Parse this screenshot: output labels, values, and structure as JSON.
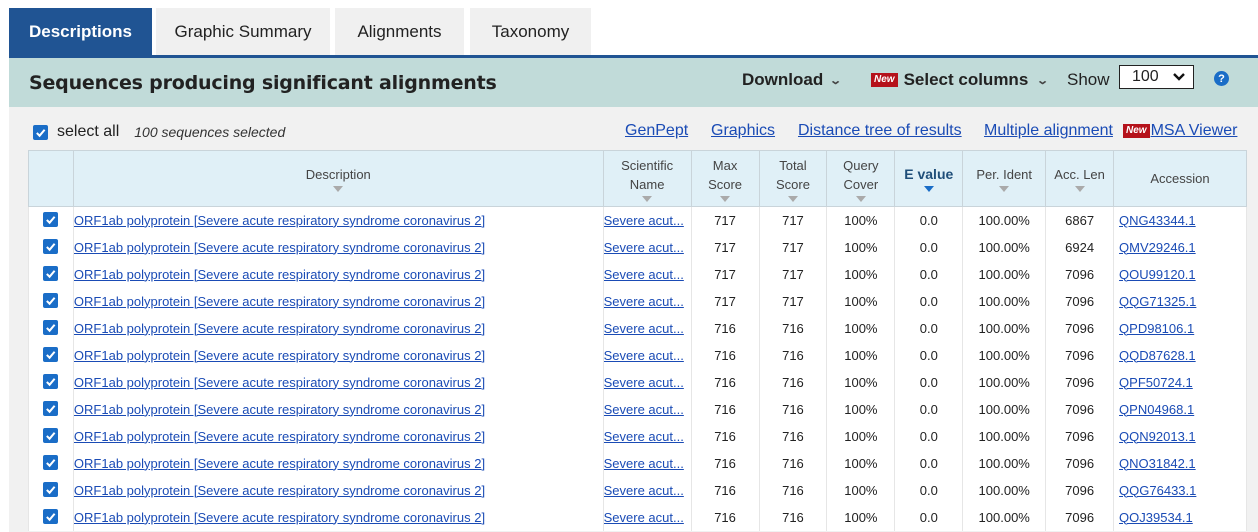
{
  "tabs": [
    "Descriptions",
    "Graphic Summary",
    "Alignments",
    "Taxonomy"
  ],
  "header": {
    "title": "Sequences producing significant alignments",
    "download_label": "Download",
    "new_badge": "New",
    "select_columns_label": "Select columns",
    "show_label": "Show",
    "show_value": "100",
    "help": "?"
  },
  "toolbar": {
    "select_all_label": "select all",
    "selected_count": "100 sequences selected",
    "links": [
      "GenPept",
      "Graphics",
      "Distance tree of results",
      "Multiple alignment"
    ],
    "msa_badge": "New",
    "msa_label": "MSA Viewer"
  },
  "table": {
    "columns": [
      [
        "Description"
      ],
      [
        "Scientific",
        "Name"
      ],
      [
        "Max",
        "Score"
      ],
      [
        "Total",
        "Score"
      ],
      [
        "Query",
        "Cover"
      ],
      [
        "E value"
      ],
      [
        "Per. Ident"
      ],
      [
        "Acc. Len"
      ],
      [
        "Accession"
      ]
    ],
    "rows": [
      {
        "description": "ORF1ab polyprotein [Severe acute respiratory syndrome coronavirus 2]",
        "sci": "Severe acut...",
        "max": "717",
        "total": "717",
        "cover": "100%",
        "evalue": "0.0",
        "ident": "100.00%",
        "len": "6867",
        "acc": "QNG43344.1"
      },
      {
        "description": "ORF1ab polyprotein [Severe acute respiratory syndrome coronavirus 2]",
        "sci": "Severe acut...",
        "max": "717",
        "total": "717",
        "cover": "100%",
        "evalue": "0.0",
        "ident": "100.00%",
        "len": "6924",
        "acc": "QMV29246.1"
      },
      {
        "description": "ORF1ab polyprotein [Severe acute respiratory syndrome coronavirus 2]",
        "sci": "Severe acut...",
        "max": "717",
        "total": "717",
        "cover": "100%",
        "evalue": "0.0",
        "ident": "100.00%",
        "len": "7096",
        "acc": "QOU99120.1"
      },
      {
        "description": "ORF1ab polyprotein [Severe acute respiratory syndrome coronavirus 2]",
        "sci": "Severe acut...",
        "max": "717",
        "total": "717",
        "cover": "100%",
        "evalue": "0.0",
        "ident": "100.00%",
        "len": "7096",
        "acc": "QQG71325.1"
      },
      {
        "description": "ORF1ab polyprotein [Severe acute respiratory syndrome coronavirus 2]",
        "sci": "Severe acut...",
        "max": "716",
        "total": "716",
        "cover": "100%",
        "evalue": "0.0",
        "ident": "100.00%",
        "len": "7096",
        "acc": "QPD98106.1"
      },
      {
        "description": "ORF1ab polyprotein [Severe acute respiratory syndrome coronavirus 2]",
        "sci": "Severe acut...",
        "max": "716",
        "total": "716",
        "cover": "100%",
        "evalue": "0.0",
        "ident": "100.00%",
        "len": "7096",
        "acc": "QQD87628.1"
      },
      {
        "description": "ORF1ab polyprotein [Severe acute respiratory syndrome coronavirus 2]",
        "sci": "Severe acut...",
        "max": "716",
        "total": "716",
        "cover": "100%",
        "evalue": "0.0",
        "ident": "100.00%",
        "len": "7096",
        "acc": "QPF50724.1"
      },
      {
        "description": "ORF1ab polyprotein [Severe acute respiratory syndrome coronavirus 2]",
        "sci": "Severe acut...",
        "max": "716",
        "total": "716",
        "cover": "100%",
        "evalue": "0.0",
        "ident": "100.00%",
        "len": "7096",
        "acc": "QPN04968.1"
      },
      {
        "description": "ORF1ab polyprotein [Severe acute respiratory syndrome coronavirus 2]",
        "sci": "Severe acut...",
        "max": "716",
        "total": "716",
        "cover": "100%",
        "evalue": "0.0",
        "ident": "100.00%",
        "len": "7096",
        "acc": "QQN92013.1"
      },
      {
        "description": "ORF1ab polyprotein [Severe acute respiratory syndrome coronavirus 2]",
        "sci": "Severe acut...",
        "max": "716",
        "total": "716",
        "cover": "100%",
        "evalue": "0.0",
        "ident": "100.00%",
        "len": "7096",
        "acc": "QNO31842.1"
      },
      {
        "description": "ORF1ab polyprotein [Severe acute respiratory syndrome coronavirus 2]",
        "sci": "Severe acut...",
        "max": "716",
        "total": "716",
        "cover": "100%",
        "evalue": "0.0",
        "ident": "100.00%",
        "len": "7096",
        "acc": "QQG76433.1"
      },
      {
        "description": "ORF1ab polyprotein [Severe acute respiratory syndrome coronavirus 2]",
        "sci": "Severe acut...",
        "max": "716",
        "total": "716",
        "cover": "100%",
        "evalue": "0.0",
        "ident": "100.00%",
        "len": "7096",
        "acc": "QOJ39534.1"
      }
    ]
  },
  "colors": {
    "tab_active": "#205493",
    "header_bg": "#c1dbd9",
    "link": "#1a4bb5",
    "checkbox": "#1a6dc7",
    "new_badge": "#b5121b"
  }
}
